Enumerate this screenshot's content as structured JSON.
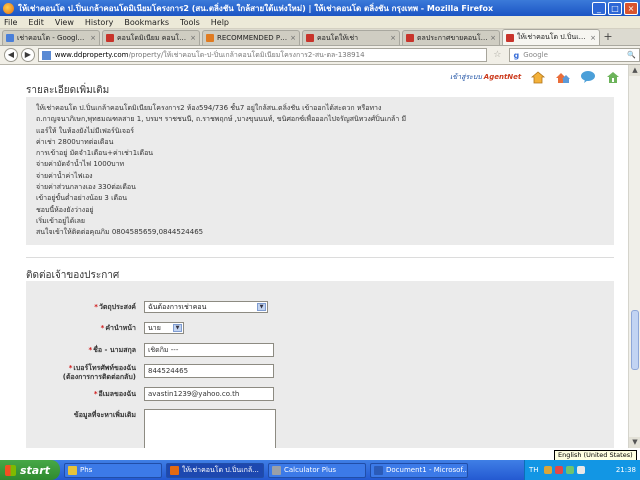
{
  "window": {
    "title": "ให้เช่าคอนโด ป.ปิ่นเกล้าคอนโดมิเนียมโครงการ2 (สน.ตลิ่งชัน ใกล้สายใต้แห่งใหม่) | ให้เช่าคอนโด ตลิ่งชัน กรุงเทพ - Mozilla Firefox",
    "minimize": "_",
    "maximize": "□",
    "close": "×"
  },
  "menu": [
    "File",
    "Edit",
    "View",
    "History",
    "Bookmarks",
    "Tools",
    "Help"
  ],
  "tabs": [
    {
      "label": "เช่าคอนโด - Google Se...",
      "color": "#4a7fd9"
    },
    {
      "label": "คอนโดมิเนียม คอนโด ที่...",
      "color": "#c8342b"
    },
    {
      "label": "RECOMMENDED PROP...",
      "color": "#e07b21"
    },
    {
      "label": "คอนโดให้เช่า",
      "color": "#c8342b"
    },
    {
      "label": "ตลประกาศขายคอนโด 1...",
      "color": "#c8342b"
    },
    {
      "label": "ให้เช่าคอนโด ป.ปิ่นเกล้...",
      "color": "#c8342b",
      "active": true
    }
  ],
  "tab_close": "×",
  "new_tab": "+",
  "nav": {
    "back": "◀",
    "forward": "▶",
    "url_domain": "www.ddproperty.com",
    "url_path": "/property/ให้เช่าคอนโด-ป-ปิ่นเกล้าคอนโดมิเนียมโครงการ2-สน-ตล-138914",
    "star": "☆",
    "search_engine": "g",
    "search_placeholder": "Google",
    "search_btn": "🔍"
  },
  "agentnet": {
    "label": "เข้าสู่ระบบ",
    "brand": "AgentNet"
  },
  "details": {
    "title": "รายละเอียดเพิ่มเติม",
    "lines": [
      "ให้เช่าคอนโด ป.ปิ่นเกล้าคอนโดมิเนียมโครงการ2 ห้อง594/736 ชั้น7 อยู่ใกล้สน.ตลิ่งชัน เข้าออกได้สะดวก หรือทาง",
      "ถ.กาญจนาภิเษก,พุทธมณฑลสาย 1, บรมฯ ราชชนนี, ถ.ราชพฤกษ์ ,บางขุนนนท์, ขนิศอกซ์เพื่อออกไปจรัญสนิทวงศ์ปิ่นเกล้า มี",
      "แอร์ให้ ในห้องยังไม่มีเฟอร์นิเจอร์",
      "ค่าเช่า 2800บาทต่อเดือน",
      "การเข้าอยู่ มัดจำ1เดือน+ค่าเช่า1เดือน",
      "จ่ายค่ามัดจำน้ำไฟ 1000บาท",
      "จ่ายค่าน้ำค่าไฟเอง",
      "จ่ายค่าส่วนกลางเอง 330ต่อเดือน",
      "เข้าอยู่ขั้นต่ำอย่างน้อย 3 เดือน",
      "ชอบนี้ห้องยังว่างอยู่",
      "เริ่มเข้าอยู่ได้เลย",
      "สนใจเข้าให้ติดต่อคุณกิม 0804585659,0844524465"
    ]
  },
  "contact": {
    "title": "ติดต่อเจ้าของประกาศ",
    "required_mark": "*",
    "purpose_label": "วัตถุประสงค์",
    "purpose_value": "ฉันต้องการเช่าคอน",
    "title_label": "คำนำหน้า",
    "title_value": "นาย",
    "name_label": "ชื่อ - นามสกุล",
    "name_value": "เชิดกิม ---",
    "phone_label": "เบอร์โทรศัพท์ของฉัน",
    "phone_sublabel": "(ต้องการการติดต่อกลับ)",
    "phone_value": "844524465",
    "email_label": "อีเมลของฉัน",
    "email_value": "avastin1239@yahoo.co.th",
    "message_label": "ข้อมูลที่จะหาเพิ่มเติม",
    "dropdown_arrow": "▼"
  },
  "scroll": {
    "up": "▲",
    "down": "▼"
  },
  "taskbar": {
    "start": "start",
    "tasks": [
      {
        "label": "Phs",
        "color": "#e6c33a"
      },
      {
        "label": "ให้เช่าคอนโด ป.ปิ่นเกล้...",
        "color": "#e46a12",
        "active": true
      },
      {
        "label": "Calculator Plus",
        "color": "#9aa0a8"
      },
      {
        "label": "Document1 - Microsof...",
        "color": "#2b5bb8"
      }
    ],
    "lang": "TH",
    "clock": "21:38",
    "tooltip": "English (United States)"
  }
}
